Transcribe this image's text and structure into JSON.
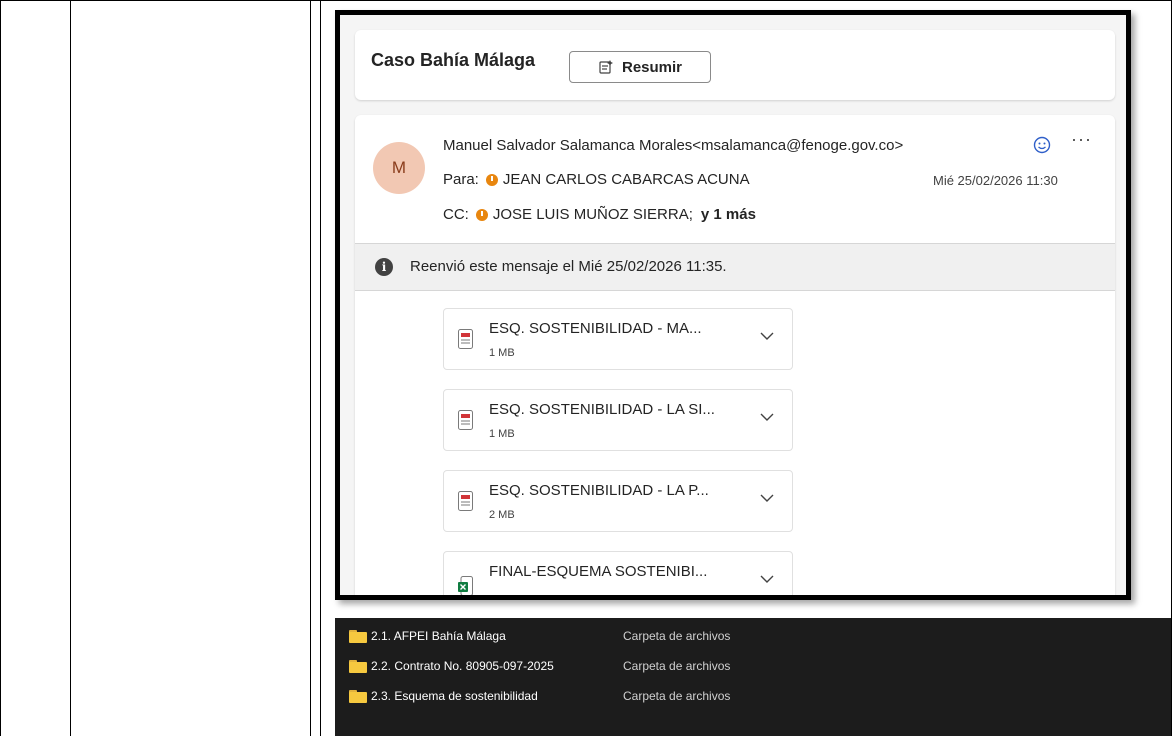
{
  "email": {
    "subject": "Caso Bahía Málaga",
    "summarize_label": "Resumir",
    "avatar_initial": "M",
    "from": "Manuel Salvador Salamanca Morales<msalamanca@fenoge.gov.co>",
    "to_label": "Para:",
    "to": "JEAN CARLOS CABARCAS ACUNA",
    "date": "Mié 25/02/2026 11:30",
    "cc_label": "CC:",
    "cc": "JOSE LUIS MUÑOZ SIERRA;",
    "cc_more": "y 1 más",
    "more_icon": "···",
    "forward_notice": "Reenvió este mensaje el Mié 25/02/2026 11:35.",
    "attachments": [
      {
        "name": "ESQ. SOSTENIBILIDAD - MA...",
        "size": "1 MB",
        "type": "pdf"
      },
      {
        "name": "ESQ. SOSTENIBILIDAD - LA SI...",
        "size": "1 MB",
        "type": "pdf"
      },
      {
        "name": "ESQ. SOSTENIBILIDAD - LA P...",
        "size": "2 MB",
        "type": "pdf"
      },
      {
        "name": "FINAL-ESQUEMA SOSTENIBI...",
        "size": "",
        "type": "excel"
      }
    ]
  },
  "explorer": {
    "rows": [
      {
        "name": "2.1. AFPEI Bahía Málaga",
        "type": "Carpeta de archivos"
      },
      {
        "name": "2.2. Contrato No. 80905-097-2025",
        "type": "Carpeta de archivos"
      },
      {
        "name": "2.3. Esquema de sostenibilidad",
        "type": "Carpeta de archivos"
      }
    ]
  },
  "colors": {
    "avatar_bg": "#f2c8b3",
    "presence_dot": "#e8860f",
    "explorer_bg": "#1c1c1c",
    "folder": "#f6c93f"
  }
}
